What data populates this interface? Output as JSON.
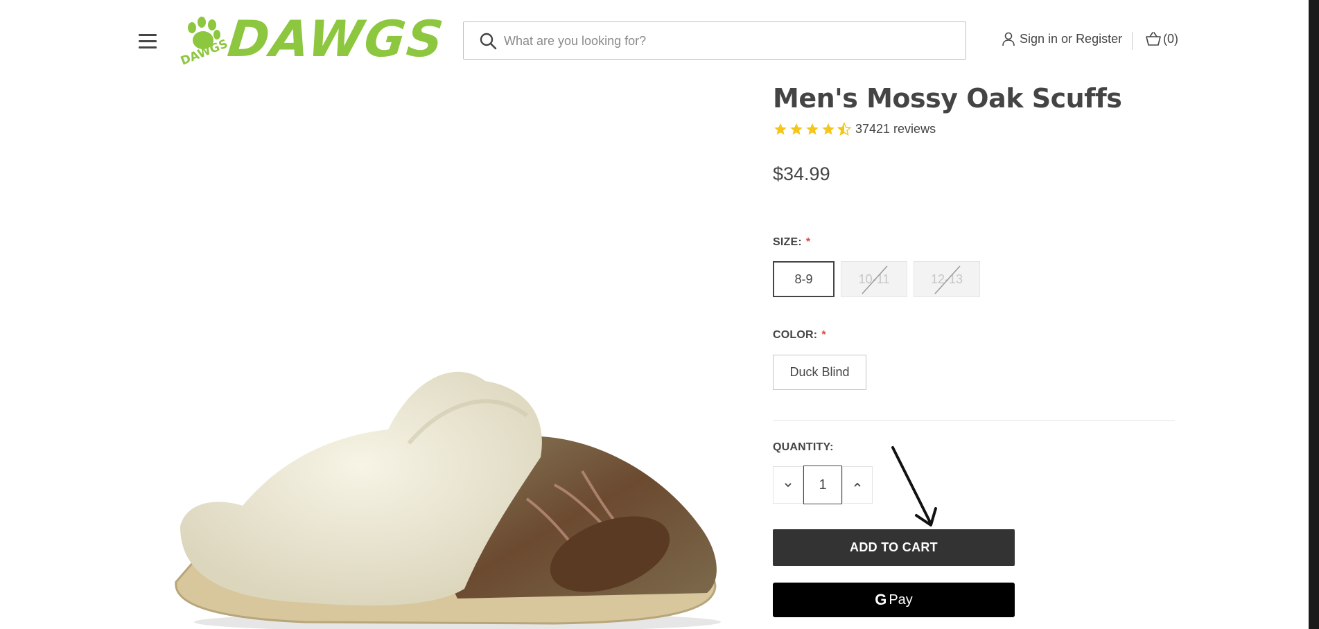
{
  "header": {
    "logo_text": "DAWGS",
    "logo_small_text": "DAWGS",
    "search": {
      "placeholder": "What are you looking for?"
    },
    "account": {
      "sign_in": "Sign in",
      "or": "or",
      "register": "Register"
    },
    "cart": {
      "label": "(0)"
    }
  },
  "product": {
    "title": "Men's Mossy Oak Scuffs",
    "rating": {
      "stars": 4.5,
      "reviews_text": "37421 reviews"
    },
    "price": "$34.99",
    "size": {
      "label": "SIZE:",
      "required": "*",
      "options": [
        {
          "label": "8-9",
          "state": "selected"
        },
        {
          "label": "10-11",
          "state": "unavailable"
        },
        {
          "label": "12-13",
          "state": "unavailable"
        }
      ]
    },
    "color": {
      "label": "COLOR:",
      "required": "*",
      "option": "Duck Blind"
    },
    "quantity": {
      "label": "QUANTITY:",
      "value": "1"
    },
    "add_to_cart": "ADD TO CART",
    "gpay": {
      "g": "G",
      "label": "Pay"
    }
  },
  "colors": {
    "brand_green": "#8dc63f",
    "button_dark": "#333333",
    "star_gold": "#f5c518",
    "required_red": "#d9473b"
  }
}
